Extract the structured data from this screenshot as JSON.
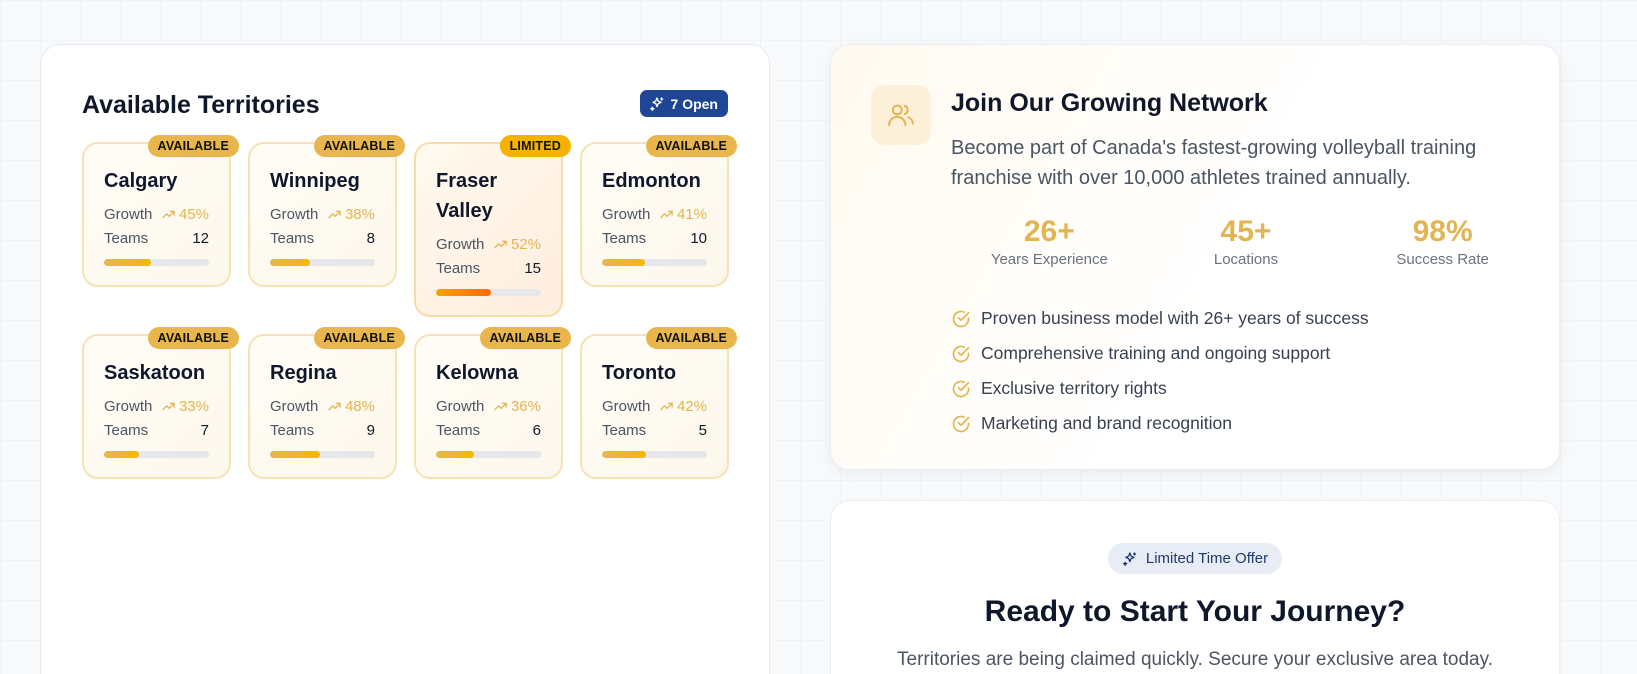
{
  "territories": {
    "title": "Available Territories",
    "open_badge": "7 Open",
    "growth_label": "Growth",
    "teams_label": "Teams",
    "cards": [
      {
        "city": "Calgary",
        "status": "AVAILABLE",
        "growth": "45%",
        "teams": "12",
        "progress": 0.45
      },
      {
        "city": "Winnipeg",
        "status": "AVAILABLE",
        "growth": "38%",
        "teams": "8",
        "progress": 0.38
      },
      {
        "city": "Fraser Valley",
        "status": "LIMITED",
        "growth": "52%",
        "teams": "15",
        "progress": 0.52
      },
      {
        "city": "Edmonton",
        "status": "AVAILABLE",
        "growth": "41%",
        "teams": "10",
        "progress": 0.41
      },
      {
        "city": "Saskatoon",
        "status": "AVAILABLE",
        "growth": "33%",
        "teams": "7",
        "progress": 0.33
      },
      {
        "city": "Regina",
        "status": "AVAILABLE",
        "growth": "48%",
        "teams": "9",
        "progress": 0.48
      },
      {
        "city": "Kelowna",
        "status": "AVAILABLE",
        "growth": "36%",
        "teams": "6",
        "progress": 0.36
      },
      {
        "city": "Toronto",
        "status": "AVAILABLE",
        "growth": "42%",
        "teams": "5",
        "progress": 0.42
      }
    ]
  },
  "join": {
    "icon": "users-icon",
    "title": "Join Our Growing Network",
    "description": "Become part of Canada's fastest-growing volleyball training franchise with over 10,000 athletes trained annually.",
    "stats": [
      {
        "value": "26+",
        "label": "Years Experience"
      },
      {
        "value": "45+",
        "label": "Locations"
      },
      {
        "value": "98%",
        "label": "Success Rate"
      }
    ],
    "features": [
      "Proven business model with 26+ years of success",
      "Comprehensive training and ongoing support",
      "Exclusive territory rights",
      "Marketing and brand recognition"
    ]
  },
  "cta": {
    "pill": "Limited Time Offer",
    "title": "Ready to Start Your Journey?",
    "subtitle": "Territories are being claimed quickly. Secure your exclusive area today."
  },
  "colors": {
    "accent": "#e2b552",
    "navy": "#1e4694",
    "limited": "#f5b000"
  }
}
